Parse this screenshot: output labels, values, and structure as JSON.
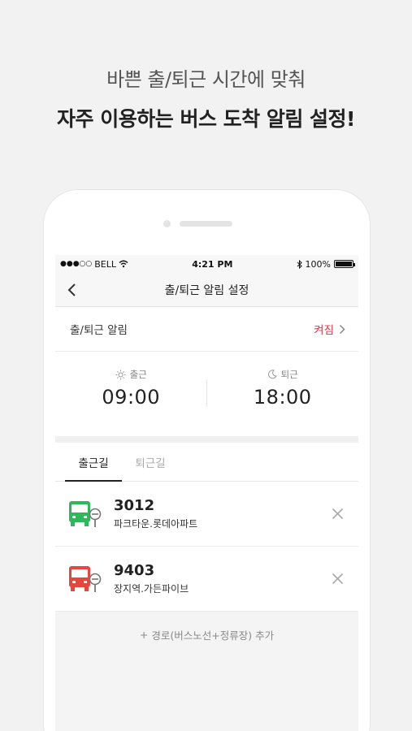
{
  "promo": {
    "line1": "바쁜 출/퇴근 시간에 맞춰",
    "line2": "자주 이용하는 버스 도착 알림 설정!"
  },
  "status_bar": {
    "carrier": "BELL",
    "time": "4:21 PM",
    "battery": "100%",
    "battery_level": 1.0
  },
  "nav": {
    "title": "출/퇴근 알림 설정"
  },
  "alarm": {
    "label": "출/퇴근 알림",
    "status": "켜짐"
  },
  "times": {
    "morning_label": "출근",
    "morning_time": "09:00",
    "evening_label": "퇴근",
    "evening_time": "18:00"
  },
  "tabs": [
    {
      "label": "출근길",
      "active": true
    },
    {
      "label": "퇴근길",
      "active": false
    }
  ],
  "routes": [
    {
      "number": "3012",
      "stop": "파크타운.롯데아파트",
      "color": "#2db85a"
    },
    {
      "number": "9403",
      "stop": "장지역.가든파이브",
      "color": "#e8453c"
    }
  ],
  "add_route": {
    "label": "경로(버스노선+정류장) 추가",
    "icon_text": "+"
  },
  "colors": {
    "accent": "#e8354b",
    "green_bus": "#2db85a",
    "red_bus": "#e8453c"
  }
}
